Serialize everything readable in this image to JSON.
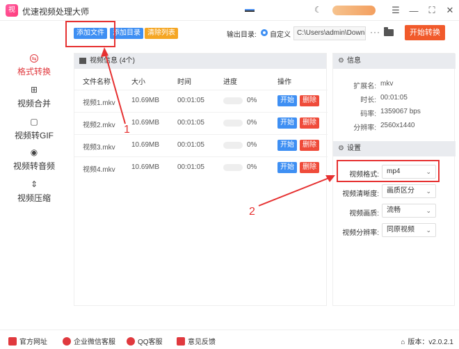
{
  "window": {
    "title": "优速视频处理大师",
    "controls": [
      "moon-icon",
      "menu-icon",
      "minimize-icon",
      "maximize-icon",
      "close-icon"
    ]
  },
  "toolbar": {
    "add_file": "添加文件",
    "add_dir": "添加目录",
    "clear_list": "清除列表",
    "output_label": "输出目录:",
    "custom_label": "自定义",
    "path_value": "C:\\Users\\admin\\Downlc",
    "more": "···",
    "start_all": "开始转换"
  },
  "sidebar": {
    "items": [
      {
        "label": "格式转换",
        "icon": "format-convert-icon",
        "active": true
      },
      {
        "label": "视频合并",
        "icon": "merge-icon",
        "active": false
      },
      {
        "label": "视频转GIF",
        "icon": "gif-icon",
        "active": false
      },
      {
        "label": "视频转音频",
        "icon": "audio-icon",
        "active": false
      },
      {
        "label": "视频压缩",
        "icon": "compress-icon",
        "active": false
      }
    ]
  },
  "main": {
    "header": "视频信息 (4个)",
    "columns": [
      "文件名称",
      "大小",
      "时间",
      "进度",
      "操作"
    ],
    "rows": [
      {
        "name": "视频1.mkv",
        "size": "10.69MB",
        "time": "00:01:05",
        "progress": "0%",
        "start": "开始",
        "delete": "删除"
      },
      {
        "name": "视频2.mkv",
        "size": "10.69MB",
        "time": "00:01:05",
        "progress": "0%",
        "start": "开始",
        "delete": "删除"
      },
      {
        "name": "视频3.mkv",
        "size": "10.69MB",
        "time": "00:01:05",
        "progress": "0%",
        "start": "开始",
        "delete": "删除"
      },
      {
        "name": "视频4.mkv",
        "size": "10.69MB",
        "time": "00:01:05",
        "progress": "0%",
        "start": "开始",
        "delete": "删除"
      }
    ]
  },
  "info": {
    "header": "信息",
    "fields": [
      {
        "key": "扩展名:",
        "value": "mkv"
      },
      {
        "key": "时长:",
        "value": "00:01:05"
      },
      {
        "key": "码率:",
        "value": "1359067 bps"
      },
      {
        "key": "分辨率:",
        "value": "2560x1440"
      }
    ]
  },
  "settings": {
    "header": "设置",
    "fields": [
      {
        "key": "视频格式:",
        "value": "mp4"
      },
      {
        "key": "视频清晰度:",
        "value": "画质区分"
      },
      {
        "key": "视频画质:",
        "value": "流畅"
      },
      {
        "key": "视频分辨率:",
        "value": "同原视频"
      }
    ]
  },
  "footer": {
    "website": "官方网址",
    "wechat": "企业微信客服",
    "qq": "QQ客服",
    "feedback": "意见反馈",
    "version": "版本：v2.0.2.1"
  },
  "annotations": {
    "label_1": "1",
    "label_2": "2",
    "color": "#e63030"
  }
}
